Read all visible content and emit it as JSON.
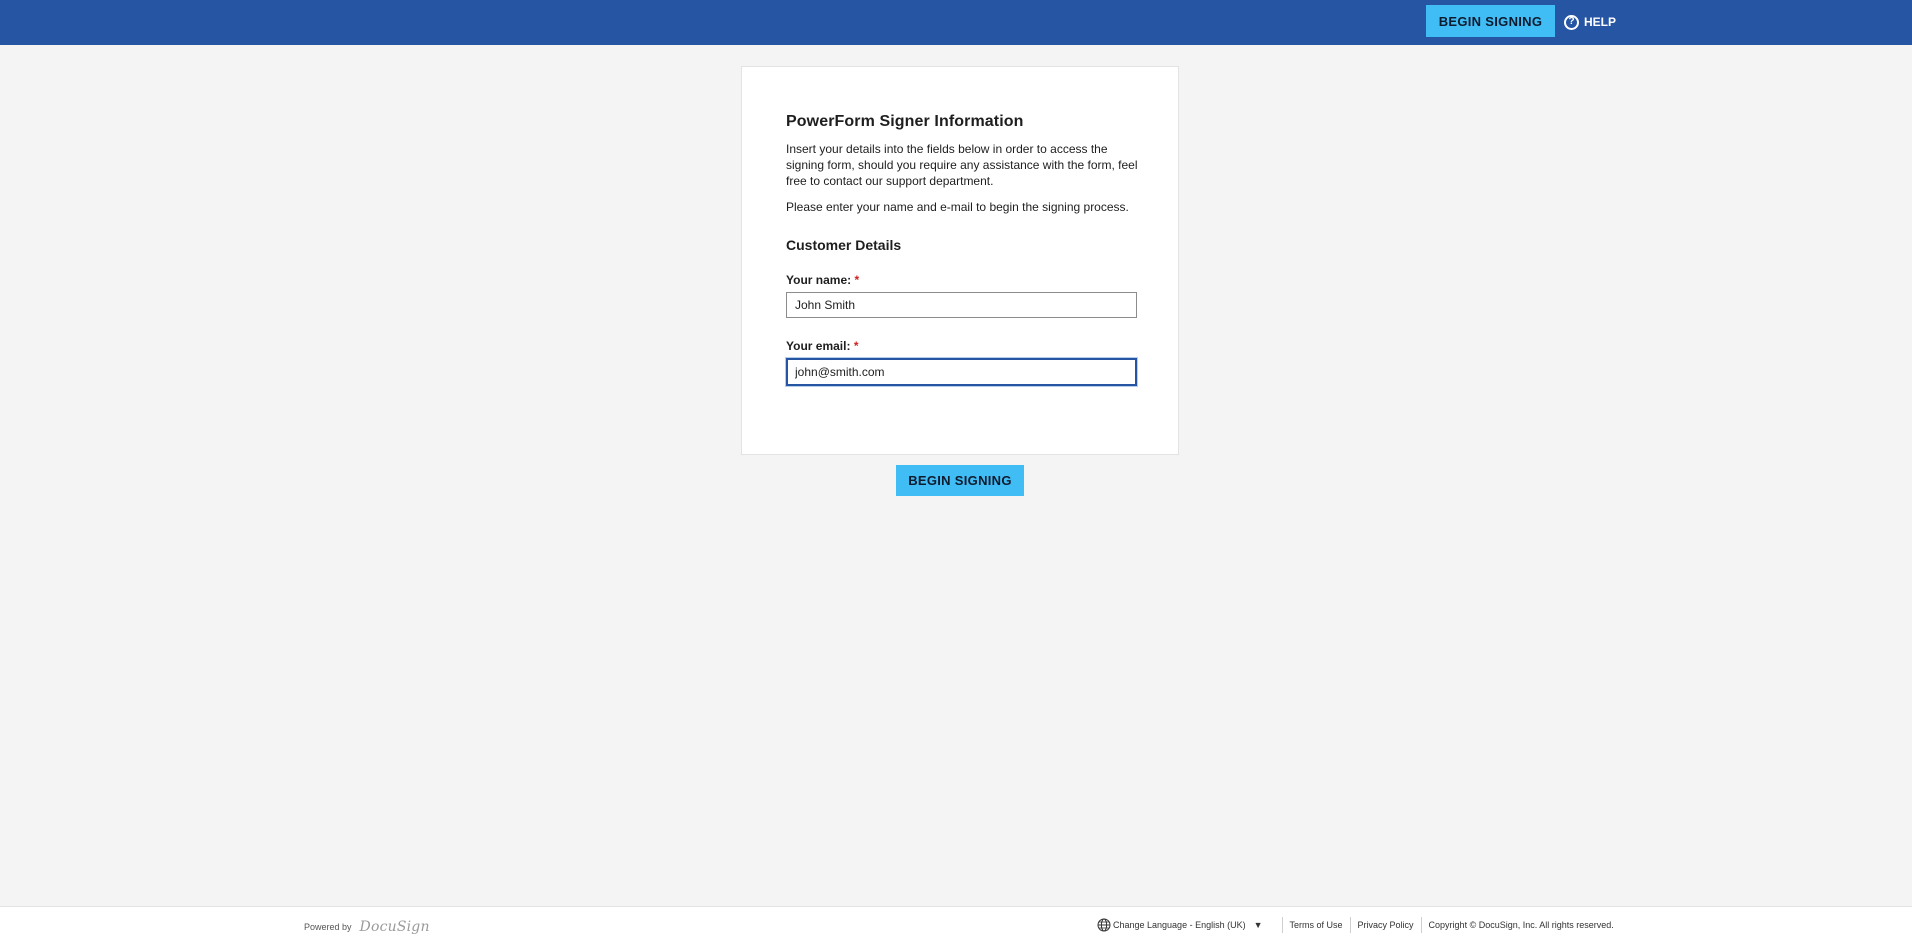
{
  "header": {
    "begin_signing": "BEGIN SIGNING",
    "help": "HELP",
    "help_icon": "question-circle-icon"
  },
  "card": {
    "title": "PowerForm Signer Information",
    "intro": "Insert your details into the fields below in order to access the signing form, should you require any assistance with the form, feel free to contact our support department.",
    "instruction": "Please enter your name and e-mail to begin the signing process.",
    "section_title": "Customer Details",
    "name_label": "Your name:",
    "name_value": "John Smith",
    "email_label": "Your email:",
    "email_value": "john@smith.com",
    "required_marker": "*"
  },
  "main": {
    "begin_signing": "BEGIN SIGNING"
  },
  "footer": {
    "powered_by": "Powered by",
    "logo": "DocuSign",
    "language": "Change Language - English (UK)",
    "terms": "Terms of Use",
    "privacy": "Privacy Policy",
    "copyright": "Copyright © DocuSign, Inc. All rights reserved."
  },
  "colors": {
    "header_bg": "#2655a3",
    "button_bg": "#41bdf5",
    "page_bg": "#f4f4f4",
    "required": "#cc2222"
  }
}
